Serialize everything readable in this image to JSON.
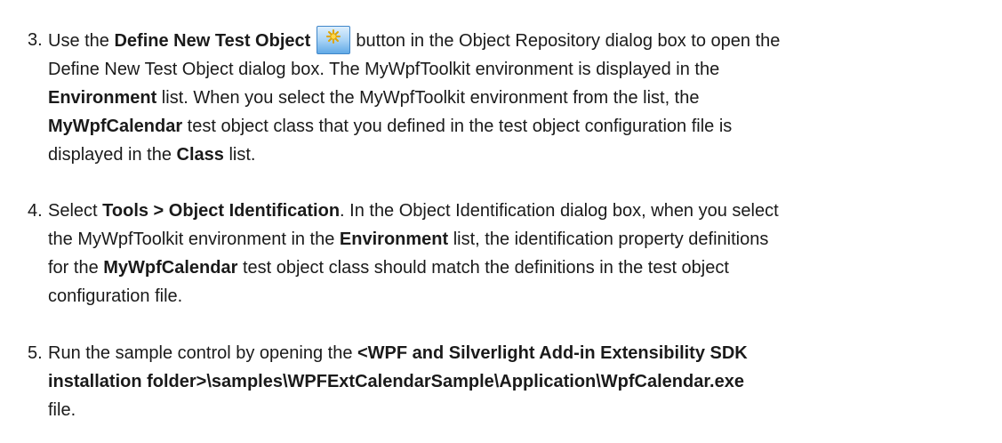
{
  "steps": [
    {
      "number": "3.",
      "lines": [
        [
          "Use the ",
          {
            "b": "Define New Test Object"
          },
          " ",
          {
            "icon": "define-new-test-object-icon"
          },
          " button in the Object Repository dialog box to open the"
        ],
        [
          "Define New Test Object dialog box. The MyWpfToolkit environment is displayed in the"
        ],
        [
          {
            "b": "Environment"
          },
          " list. When you select the MyWpfToolkit environment from the list, the"
        ],
        [
          {
            "b": "MyWpfCalendar"
          },
          " test object class that you defined in the test object configuration file is"
        ],
        [
          "displayed in the ",
          {
            "b": "Class"
          },
          " list."
        ]
      ]
    },
    {
      "number": "4.",
      "lines": [
        [
          "Select ",
          {
            "b": "Tools > Object Identification"
          },
          ". In the Object Identification dialog box, when you select"
        ],
        [
          "the MyWpfToolkit environment in the ",
          {
            "b": "Environment"
          },
          " list, the identification property definitions"
        ],
        [
          "for the ",
          {
            "b": "MyWpfCalendar"
          },
          " test object class should match the definitions in the test object"
        ],
        [
          "configuration file."
        ]
      ]
    },
    {
      "number": "5.",
      "lines": [
        [
          "Run the sample control by opening the ",
          {
            "b": "<WPF and Silverlight Add-in Extensibility SDK"
          }
        ],
        [
          {
            "b": "installation folder>\\samples\\WPFExtCalendarSample\\Application\\WpfCalendar.exe"
          }
        ],
        [
          "file."
        ]
      ]
    }
  ],
  "colors": {
    "text": "#1a1a1a",
    "icon_bg_top": "#c9e6fb",
    "icon_bg_bottom": "#6fb5ec",
    "icon_border": "#3f86c9",
    "icon_star": "#f2b705"
  }
}
